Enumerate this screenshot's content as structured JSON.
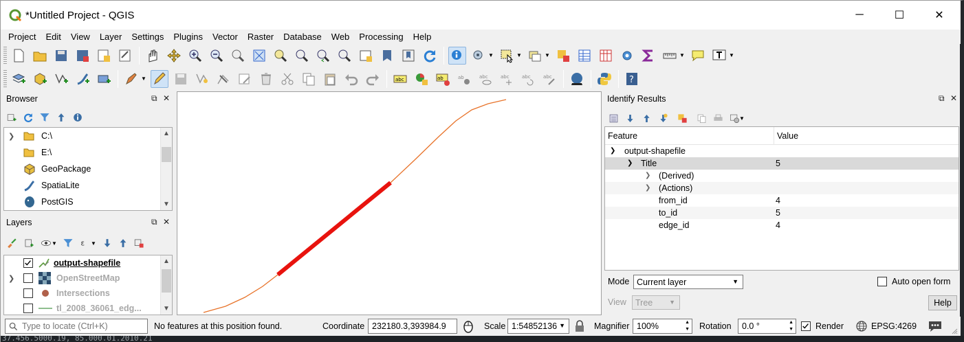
{
  "window": {
    "title": "*Untitled Project - QGIS",
    "minimize": "─",
    "maximize": "☐",
    "close": "✕"
  },
  "menu": [
    "Project",
    "Edit",
    "View",
    "Layer",
    "Settings",
    "Plugins",
    "Vector",
    "Raster",
    "Database",
    "Web",
    "Processing",
    "Help"
  ],
  "browser": {
    "title": "Browser",
    "items": [
      {
        "label": "C:\\",
        "icon": "folder-icon",
        "expandable": true
      },
      {
        "label": "E:\\",
        "icon": "folder-icon",
        "expandable": false
      },
      {
        "label": "GeoPackage",
        "icon": "geopackage-icon",
        "expandable": false
      },
      {
        "label": "SpatiaLite",
        "icon": "spatialite-icon",
        "expandable": false
      },
      {
        "label": "PostGIS",
        "icon": "postgis-icon",
        "expandable": false
      }
    ]
  },
  "layers": {
    "title": "Layers",
    "items": [
      {
        "label": "output-shapefile",
        "checked": true,
        "active": true,
        "icon": "line-layer-icon"
      },
      {
        "label": "OpenStreetMap",
        "checked": false,
        "active": false,
        "icon": "raster-layer-icon"
      },
      {
        "label": "Intersections",
        "checked": false,
        "active": false,
        "icon": "point-layer-icon"
      },
      {
        "label": "tl_2008_36061_edg...",
        "checked": false,
        "active": false,
        "icon": "line-layer-icon"
      }
    ]
  },
  "identify": {
    "title": "Identify Results",
    "col_feature": "Feature",
    "col_value": "Value",
    "layer_name": "output-shapefile",
    "title_label": "Title",
    "title_value": "5",
    "derived": "(Derived)",
    "actions": "(Actions)",
    "attributes": [
      {
        "name": "from_id",
        "value": "4"
      },
      {
        "name": "to_id",
        "value": "5"
      },
      {
        "name": "edge_id",
        "value": "4"
      }
    ],
    "mode_label": "Mode",
    "mode_value": "Current layer",
    "auto_open_label": "Auto open form",
    "view_label": "View",
    "view_value": "Tree",
    "help_label": "Help"
  },
  "status": {
    "locate_placeholder": "Type to locate (Ctrl+K)",
    "message": "No features at this position found.",
    "coordinate_label": "Coordinate",
    "coordinate_value": "232180.3,393984.9",
    "scale_label": "Scale",
    "scale_value": "1:54852136",
    "magnifier_label": "Magnifier",
    "magnifier_value": "100%",
    "rotation_label": "Rotation",
    "rotation_value": "0.0 °",
    "render_label": "Render",
    "crs_label": "EPSG:4269"
  },
  "terminal_strip": "37.456.5000.19, 85.000.01.2010.21"
}
